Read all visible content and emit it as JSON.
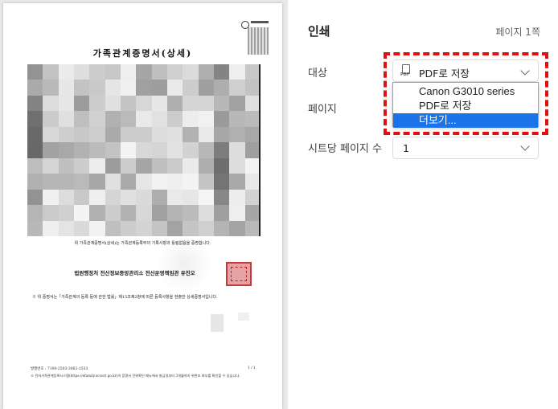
{
  "preview": {
    "title": "가족관계증명서(상세)",
    "note": "위 가족관계증명서(상세)는 가족관계등록부의 기록사항과 틀림없음을 증명합니다.",
    "issuer": "법원행정처 전산정보중앙관리소 전산운영책임관 유진오",
    "body": "※ 위 증명서는「가족관계의 등록 등에 관한 법률」제15조제3항에 따른 등록사항을 현출한 상세증명서입니다.",
    "issue_no": "발행번호 : 7100-2503-3062-1533",
    "page_no": "1 / 1",
    "footer": "※ 전자가족관계등록시스템(https://efamily.scourt.go.kr)의 증명서 진위확인 메뉴에서 발급일부터 3개월까지 위변조 여부를 확인할 수 있습니다."
  },
  "panel": {
    "title": "인쇄",
    "page_count": "페이지 1쪽",
    "destination_label": "대상",
    "destination_value": "PDF로 저장",
    "pages_label": "페이지",
    "pages_per_sheet_label": "시트당 페이지 수",
    "pages_per_sheet_value": "1",
    "dropdown_options": [
      "Canon G3010 series",
      "PDF로 저장",
      "더보기..."
    ],
    "highlighted_option": "더보기...",
    "accent_color": "#1a73e8",
    "annotation_color": "#e01010"
  }
}
